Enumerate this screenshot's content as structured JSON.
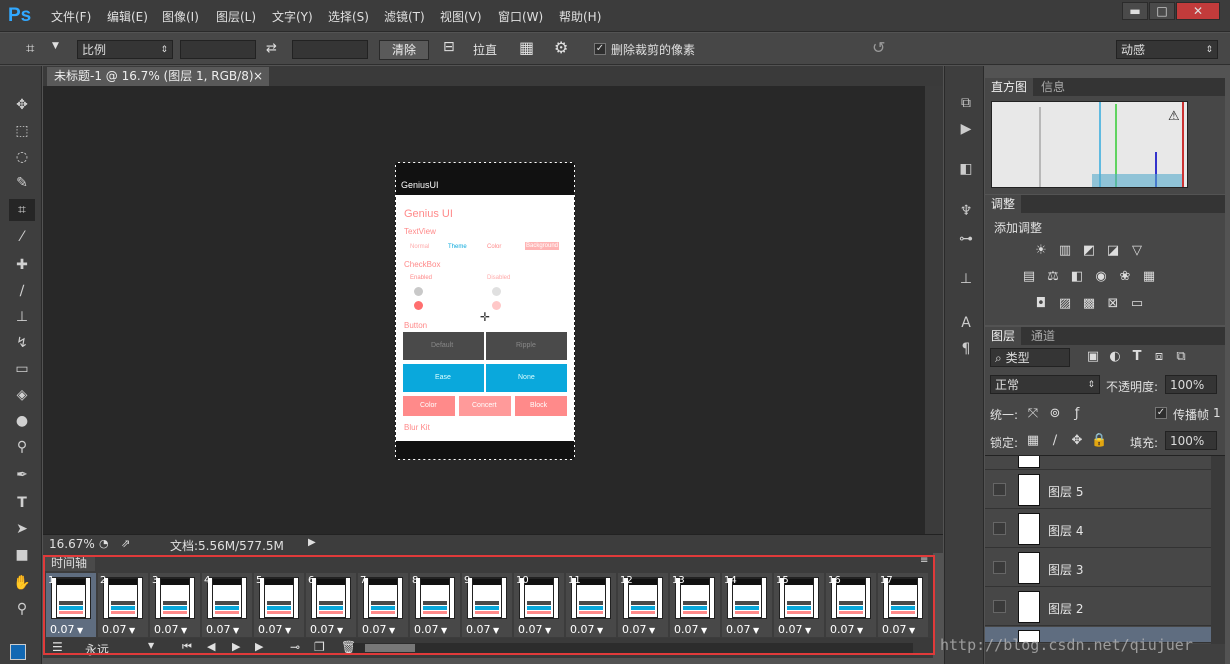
{
  "app": {
    "logo": "Ps"
  },
  "menu": [
    "文件(F)",
    "编辑(E)",
    "图像(I)",
    "图层(L)",
    "文字(Y)",
    "选择(S)",
    "滤镜(T)",
    "视图(V)",
    "窗口(W)",
    "帮助(H)"
  ],
  "window_controls": {
    "minimize": "▬",
    "maximize": "□",
    "close": "✕"
  },
  "options": {
    "ratio_select": "比例",
    "clear_button": "清除",
    "straighten_label": "拉直",
    "delete_cropped_label": "删除裁剪的像素",
    "delete_cropped_checked": true,
    "workspace_select": "动感"
  },
  "document": {
    "tab_title": "未标题-1 @ 16.7% (图层 1, RGB/8)",
    "close": "×"
  },
  "status": {
    "zoom": "16.67%",
    "doc_info": "文档:5.56M/577.5M"
  },
  "phone": {
    "appbar_title": "GeniusUI",
    "heading": "Genius UI",
    "section_textview": "TextView",
    "tv_items": [
      "Normal",
      "Theme",
      "Color",
      "Background"
    ],
    "section_checkbox": "CheckBox",
    "cb_enabled": "Enabled",
    "cb_disabled": "Disabled",
    "section_button": "Button",
    "buttons_row1": [
      "Default",
      "Ripple"
    ],
    "buttons_row2": [
      "Ease",
      "None"
    ],
    "buttons_row3": [
      "Color",
      "Concert",
      "Block"
    ],
    "section_blur": "Blur Kit",
    "colors": {
      "accent": "#ff8a8a",
      "blue": "#0aa8dc",
      "dark": "#4a4a4a"
    }
  },
  "timeline": {
    "title": "时间轴",
    "frames": [
      {
        "num": "1",
        "dur": "0.07"
      },
      {
        "num": "2",
        "dur": "0.07"
      },
      {
        "num": "3",
        "dur": "0.07"
      },
      {
        "num": "4",
        "dur": "0.07"
      },
      {
        "num": "5",
        "dur": "0.07"
      },
      {
        "num": "6",
        "dur": "0.07"
      },
      {
        "num": "7",
        "dur": "0.07"
      },
      {
        "num": "8",
        "dur": "0.07"
      },
      {
        "num": "9",
        "dur": "0.07"
      },
      {
        "num": "10",
        "dur": "0.07"
      },
      {
        "num": "11",
        "dur": "0.07"
      },
      {
        "num": "12",
        "dur": "0.07"
      },
      {
        "num": "13",
        "dur": "0.07"
      },
      {
        "num": "14",
        "dur": "0.07"
      },
      {
        "num": "15",
        "dur": "0.07"
      },
      {
        "num": "16",
        "dur": "0.07"
      },
      {
        "num": "17",
        "dur": "0.07"
      }
    ],
    "loop_label": "永远"
  },
  "panels": {
    "histogram_tabs": [
      "直方图",
      "信息"
    ],
    "adjust_tab": "调整",
    "adjust_title": "添加调整",
    "layers_tabs": [
      "图层",
      "通道"
    ],
    "filter_kind": "类型",
    "blend_mode": "正常",
    "opacity_label": "不透明度:",
    "opacity_value": "100%",
    "unify_label": "统一:",
    "propagate_label": "传播帧",
    "propagate_value": "1",
    "lock_label": "锁定:",
    "fill_label": "填充:",
    "fill_value": "100%",
    "layers": [
      "图层 5",
      "图层 4",
      "图层 3",
      "图层 2"
    ]
  },
  "watermark": "http://blog.csdn.net/qiujuer"
}
